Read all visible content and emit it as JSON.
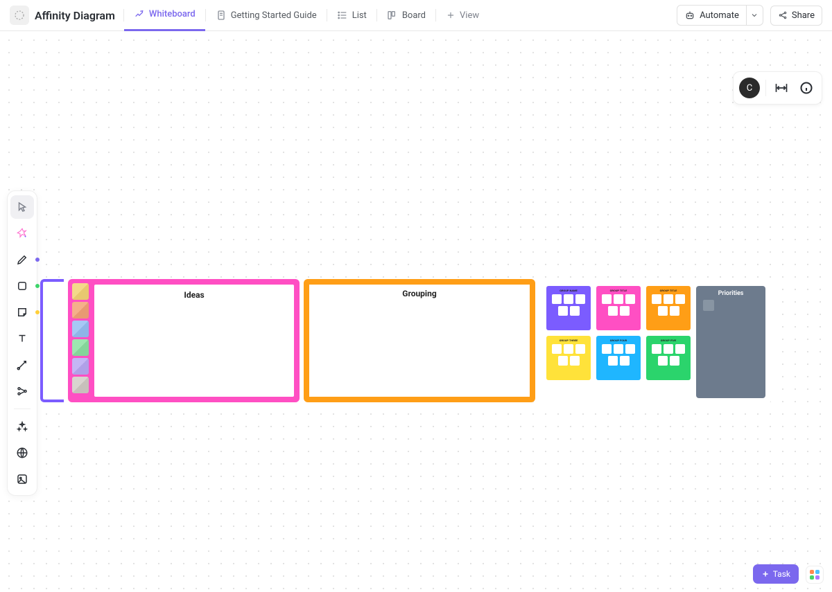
{
  "title": "Affinity Diagram",
  "tabs": {
    "whiteboard": "Whiteboard",
    "guide": "Getting Started Guide",
    "list": "List",
    "board": "Board",
    "view": "View"
  },
  "header": {
    "automate": "Automate",
    "share": "Share"
  },
  "avatar": {
    "initial": "C"
  },
  "toolbar": {
    "dots": {
      "ai": "#7b68ee",
      "pen": "#7b68ee",
      "shape": "#3dd46a",
      "sticky": "#ffcf3a"
    }
  },
  "whiteboard": {
    "ideas_title": "Ideas",
    "grouping_title": "Grouping",
    "color_chips": [
      "#f4d98a",
      "#f5b08a",
      "#a6c8f5",
      "#9de6b0",
      "#c4b6f5",
      "#d9d3cf"
    ],
    "cards": [
      {
        "color": "#7b5cff",
        "title": "GROUP NAME"
      },
      {
        "color": "#ff4fc3",
        "title": "GROUP TITLE"
      },
      {
        "color": "#ff9e16",
        "title": "GROUP TITLE"
      },
      {
        "color": "#ffe23a",
        "title": "GROUP THREE"
      },
      {
        "color": "#1fb6ff",
        "title": "GROUP FOUR"
      },
      {
        "color": "#2bd46c",
        "title": "GROUP FIVE"
      }
    ],
    "priorities_title": "Priorities"
  },
  "fab": {
    "task": "Task"
  }
}
